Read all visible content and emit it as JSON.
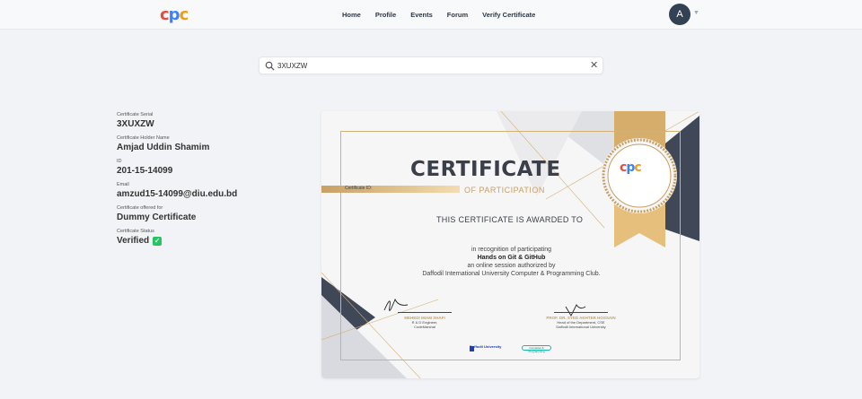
{
  "header": {
    "logo": [
      "c",
      "p",
      "c"
    ],
    "nav": [
      "Home",
      "Profile",
      "Events",
      "Forum",
      "Verify Certificate"
    ],
    "avatar_initial": "A"
  },
  "search": {
    "value": "3XUXZW",
    "icon": "search-icon",
    "clear_icon": "close-icon"
  },
  "details": [
    {
      "label": "Certificate Serial",
      "value": "3XUXZW"
    },
    {
      "label": "Certificate Holder Name",
      "value": "Amjad Uddin Shamim"
    },
    {
      "label": "ID",
      "value": "201-15-14099"
    },
    {
      "label": "Email",
      "value": "amzud15-14099@diu.edu.bd"
    },
    {
      "label": "Certificate offered for",
      "value": "Dummy Certificate"
    },
    {
      "label": "Certificate Status",
      "value": "Verified"
    }
  ],
  "certificate": {
    "title": "CERTIFICATE",
    "subtitle": "OF PARTICIPATION",
    "id_label": "Certificate ID:",
    "awarded": "THIS CERTIFICATE IS AWARDED TO",
    "line1": "in recognition of participating",
    "line2": "Hands on Git & GitHub",
    "line3": "an online session authorized by",
    "line4": "Daffodil International University Computer & Programming Club.",
    "sig1": {
      "name": "MEHEDI IMAM SHAFI",
      "role": "R & D Engineer,",
      "org": "CodeMarshal"
    },
    "sig2": {
      "name": "PROF. DR. SYED AKHTER HOSSAIN",
      "role": "Head of the Department, CSE",
      "org": "Daffodil International University"
    },
    "footer_logo1": "Daffodil University",
    "footer_logo2": "Computer & Programming"
  },
  "colors": {
    "gold": "#c9a063",
    "navy": "#3a3f4a",
    "verified": "#22c55e"
  }
}
